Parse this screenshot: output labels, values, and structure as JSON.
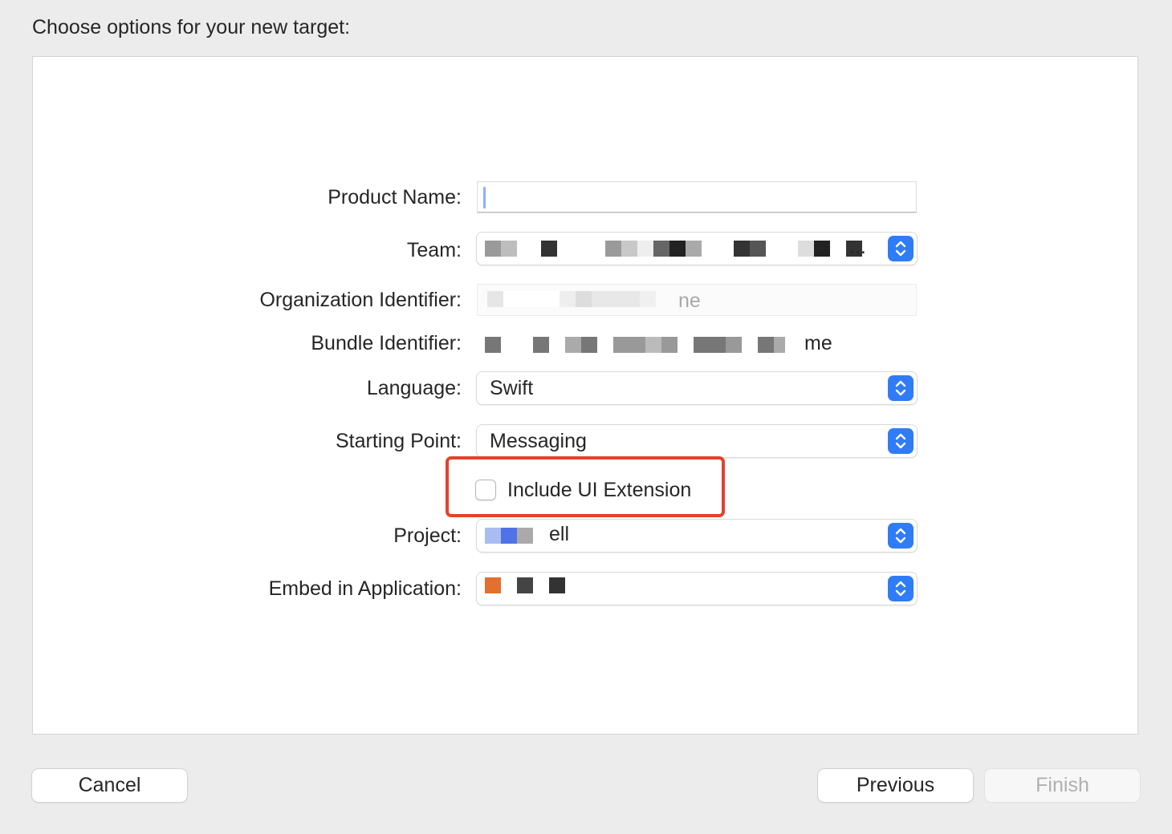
{
  "dialog": {
    "heading": "Choose options for your new target:"
  },
  "form": {
    "product_name": {
      "label": "Product Name:",
      "value": ""
    },
    "team": {
      "label": "Team:",
      "value_suffix": "..."
    },
    "organization_identifier": {
      "label": "Organization Identifier:",
      "value_fragment": "ne"
    },
    "bundle_identifier": {
      "label": "Bundle Identifier:",
      "value_fragment": "me"
    },
    "language": {
      "label": "Language:",
      "value": "Swift"
    },
    "starting_point": {
      "label": "Starting Point:",
      "value": "Messaging"
    },
    "include_ui_extension": {
      "label": "Include UI Extension",
      "checked": false,
      "highlight_color": "#e5412d"
    },
    "project": {
      "label": "Project:",
      "value_fragment": "ell"
    },
    "embed_in_application": {
      "label": "Embed in Application:"
    }
  },
  "buttons": {
    "cancel": "Cancel",
    "previous": "Previous",
    "finish": "Finish",
    "finish_enabled": false
  },
  "colors": {
    "accent": "#2f7cf6",
    "window_bg": "#ececec",
    "panel_bg": "#ffffff"
  },
  "icons": {
    "popup_stepper": "chevron-up-down-icon"
  }
}
